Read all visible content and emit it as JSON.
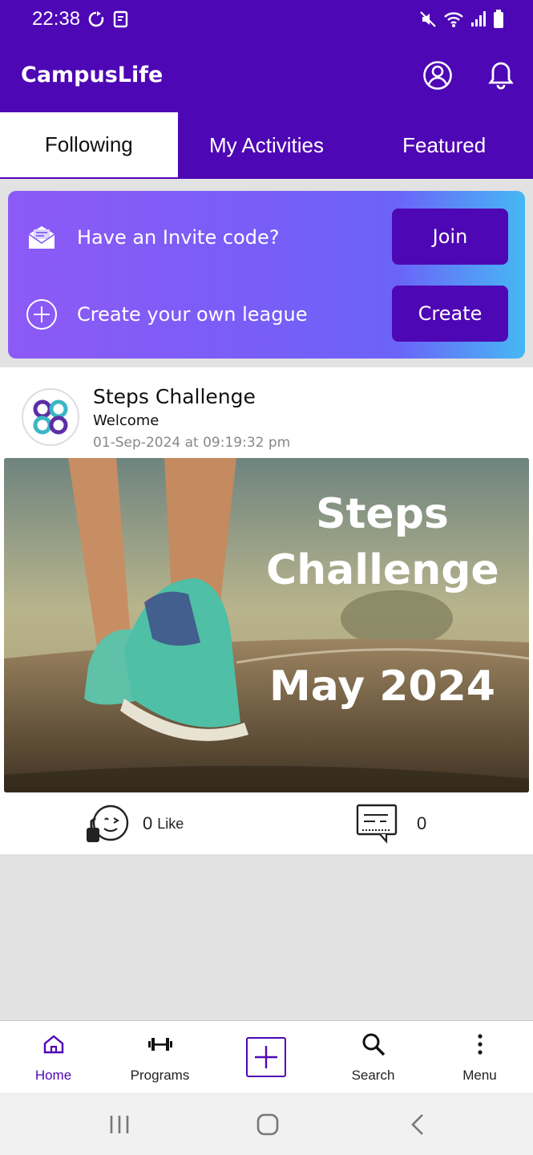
{
  "status_bar": {
    "time": "22:38"
  },
  "app": {
    "title": "CampusLife"
  },
  "tabs": [
    {
      "label": "Following",
      "active": true
    },
    {
      "label": "My Activities",
      "active": false
    },
    {
      "label": "Featured",
      "active": false
    }
  ],
  "invite_card": {
    "invite_label": "Have an Invite code?",
    "join_label": "Join",
    "create_label": "Create your own league",
    "create_button": "Create"
  },
  "post": {
    "title": "Steps Challenge",
    "subtitle": "Welcome",
    "date": "01-Sep-2024 at 09:19:32 pm",
    "image_text_line1": "Steps",
    "image_text_line2": "Challenge",
    "image_text_line3": "May 2024",
    "like_count": "0",
    "like_label": "Like",
    "comment_count": "0"
  },
  "bottom_nav": [
    {
      "label": "Home",
      "icon": "home-icon",
      "active": true
    },
    {
      "label": "Programs",
      "icon": "dumbbell-icon",
      "active": false
    },
    {
      "label": "",
      "icon": "plus-icon",
      "active": false
    },
    {
      "label": "Search",
      "icon": "search-icon",
      "active": false
    },
    {
      "label": "Menu",
      "icon": "more-vertical-icon",
      "active": false
    }
  ],
  "colors": {
    "brand": "#4e07b4",
    "gradient_start": "#8d5af6",
    "gradient_end": "#46b8f4"
  }
}
